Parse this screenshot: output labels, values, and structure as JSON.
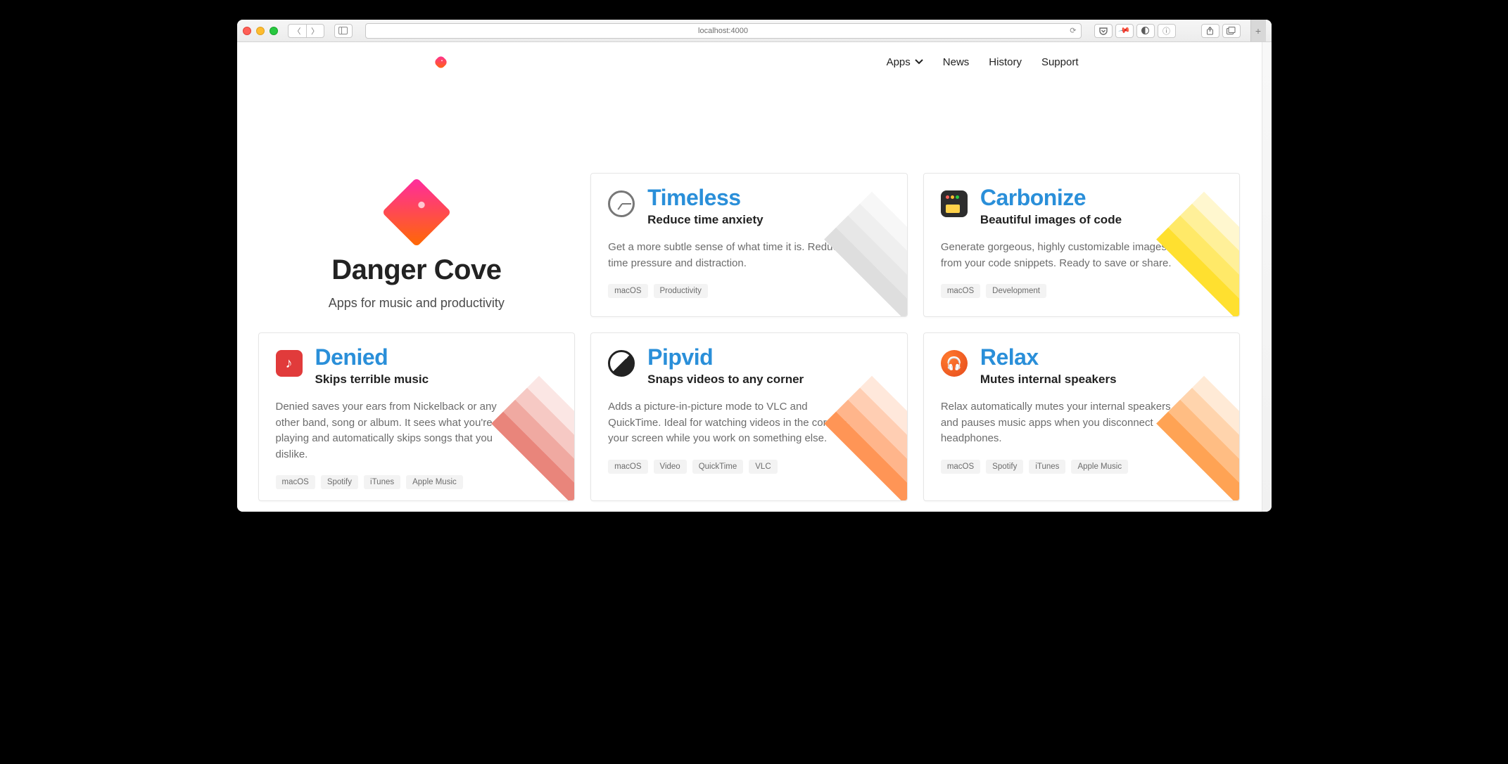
{
  "browser": {
    "url": "localhost:4000"
  },
  "site": {
    "nav": {
      "apps": "Apps",
      "news": "News",
      "history": "History",
      "support": "Support"
    },
    "hero": {
      "title": "Danger Cove",
      "tagline": "Apps for music and productivity"
    }
  },
  "apps": {
    "timeless": {
      "name": "Timeless",
      "subtitle": "Reduce time anxiety",
      "desc": "Get a more subtle sense of what time it is. Reducing time pressure and distraction.",
      "tags": [
        "macOS",
        "Productivity"
      ],
      "stripe_colors": [
        "#f7f7f7",
        "#efefef",
        "#e7e7e7",
        "#dedede"
      ]
    },
    "carbonize": {
      "name": "Carbonize",
      "subtitle": "Beautiful images of code",
      "desc": "Generate gorgeous, highly customizable images from your code snippets. Ready to save or share.",
      "tags": [
        "macOS",
        "Development"
      ],
      "stripe_colors": [
        "#fff7cf",
        "#fff099",
        "#ffe968",
        "#ffe02f"
      ]
    },
    "denied": {
      "name": "Denied",
      "subtitle": "Skips terrible music",
      "desc": "Denied saves your ears from Nickelback or any other band, song or album. It sees what you're playing and automatically skips songs that you dislike.",
      "tags": [
        "macOS",
        "Spotify",
        "iTunes",
        "Apple Music"
      ],
      "stripe_colors": [
        "#fbe6e4",
        "#f6c9c4",
        "#f0a9a1",
        "#e9857b"
      ]
    },
    "pipvid": {
      "name": "Pipvid",
      "subtitle": "Snaps videos to any corner",
      "desc": "Adds a picture-in-picture mode to VLC and QuickTime. Ideal for watching videos in the corner of your screen while you work on something else.",
      "tags": [
        "macOS",
        "Video",
        "QuickTime",
        "VLC"
      ],
      "stripe_colors": [
        "#ffe8db",
        "#ffceb3",
        "#ffb58b",
        "#ff9556"
      ]
    },
    "relax": {
      "name": "Relax",
      "subtitle": "Mutes internal speakers",
      "desc": "Relax automatically mutes your internal speakers and pauses music apps when you disconnect headphones.",
      "tags": [
        "macOS",
        "Spotify",
        "iTunes",
        "Apple Music"
      ],
      "stripe_colors": [
        "#ffead6",
        "#ffd4ad",
        "#ffbd83",
        "#ffa354"
      ]
    }
  }
}
